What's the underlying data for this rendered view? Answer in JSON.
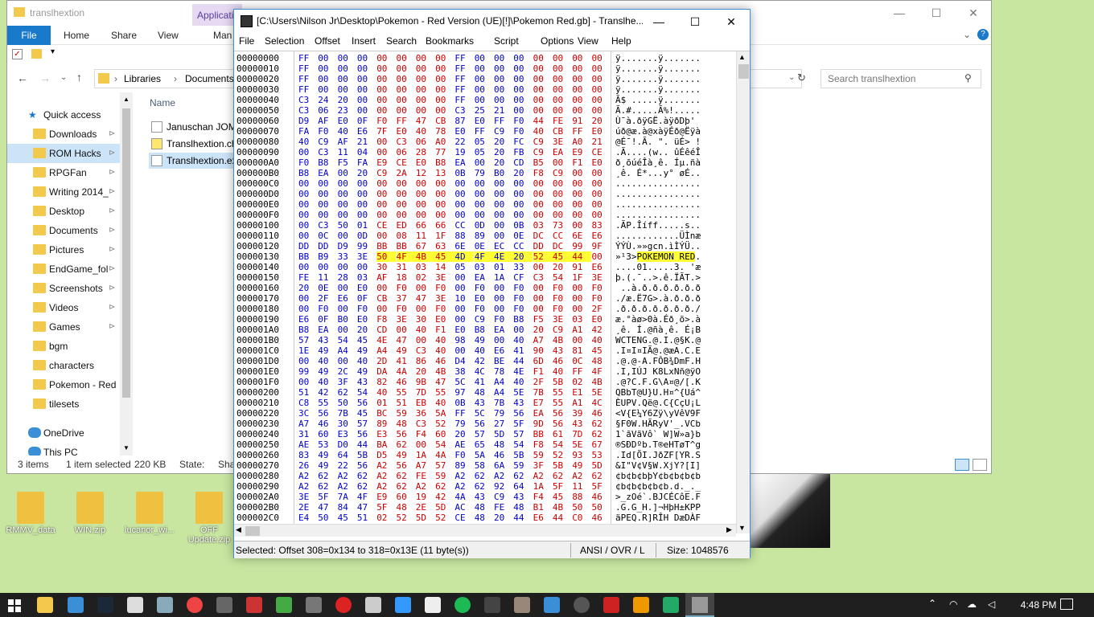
{
  "explorer": {
    "title": "translhextion",
    "app_tab": "Application",
    "ribbon_tabs": [
      "File",
      "Home",
      "Share",
      "View",
      "Man"
    ],
    "breadcrumb": [
      "Libraries",
      "Documents"
    ],
    "search_placeholder": "Search translhextion",
    "column_name": "Name",
    "nav_items": [
      {
        "label": "Quick access",
        "pinned": false
      },
      {
        "label": "Downloads",
        "pinned": true
      },
      {
        "label": "ROM Hacks",
        "pinned": true,
        "selected": true
      },
      {
        "label": "RPGFan",
        "pinned": true
      },
      {
        "label": "Writing 2014_",
        "pinned": true
      },
      {
        "label": "Desktop",
        "pinned": true
      },
      {
        "label": "Documents",
        "pinned": true
      },
      {
        "label": "Pictures",
        "pinned": true
      },
      {
        "label": "EndGame_fol",
        "pinned": true
      },
      {
        "label": "Screenshots",
        "pinned": true
      },
      {
        "label": "Videos",
        "pinned": true
      },
      {
        "label": "Games",
        "pinned": true
      },
      {
        "label": "bgm",
        "pinned": false
      },
      {
        "label": "characters",
        "pinned": false
      },
      {
        "label": "Pokemon - Red",
        "pinned": false
      },
      {
        "label": "tilesets",
        "pinned": false
      },
      {
        "label": "OneDrive",
        "pinned": false
      },
      {
        "label": "This PC",
        "pinned": false
      }
    ],
    "files": [
      "Januschan JOM",
      "Translhextion.ch",
      "Translhextion.ex"
    ],
    "status": {
      "items": "3 items",
      "selected": "1 item selected",
      "size": "220 KB",
      "state": "State:",
      "state_val": "Sha"
    }
  },
  "desktop_icons": [
    "RMMV_data",
    "WIN.zip",
    "lucanor_wi...",
    "OFF Update.zip"
  ],
  "hexeditor": {
    "title": "[C:\\Users\\Nilson Jr\\Desktop\\Pokemon - Red Version (UE)[!]\\Pokemon Red.gb] - Translhe...",
    "menu": [
      "File",
      "Selection",
      "Offset",
      "Insert",
      "Search",
      "Bookmarks",
      "Script",
      "Options",
      "View",
      "Help"
    ],
    "rows": [
      {
        "off": "00000000",
        "hex": "FF 00 00 00 00 00 00 00 FF 00 00 00 00 00 00 00",
        "asc": "ÿ.......ÿ......."
      },
      {
        "off": "00000010",
        "hex": "FF 00 00 00 00 00 00 00 FF 00 00 00 00 00 00 00",
        "asc": "ÿ.......ÿ......."
      },
      {
        "off": "00000020",
        "hex": "FF 00 00 00 00 00 00 00 FF 00 00 00 00 00 00 00",
        "asc": "ÿ.......ÿ......."
      },
      {
        "off": "00000030",
        "hex": "FF 00 00 00 00 00 00 00 FF 00 00 00 00 00 00 00",
        "asc": "ÿ.......ÿ......."
      },
      {
        "off": "00000040",
        "hex": "C3 24 20 00 00 00 00 00 FF 00 00 00 00 00 00 00",
        "asc": "Ã$ .....ÿ......."
      },
      {
        "off": "00000050",
        "hex": "C3 06 23 00 00 00 00 00 C3 25 21 00 00 00 00 00",
        "asc": "Ã.#.....Ã%!....."
      },
      {
        "off": "00000060",
        "hex": "D9 AF E0 0F F0 FF 47 CB 87 E0 FF F0 44 FE 91 20",
        "asc": "Ù¯à.ðÿGË.àÿðDþ' "
      },
      {
        "off": "00000070",
        "hex": "FA F0 40 E6 7F E0 40 78 E0 FF C9 F0 40 CB FF E0",
        "asc": "úð@æ.à@xàÿÉð@Ëÿà"
      },
      {
        "off": "00000080",
        "hex": "40 C9 AF 21 00 C3 06 A0 22 05 20 FC C9 3E A0 21",
        "asc": "@É¯!.Ã. \". üÉ> !"
      },
      {
        "off": "00000090",
        "hex": "00 C3 11 04 00 06 28 77 19 05 20 FB C9 EA E9 CE",
        "asc": ".Ã....(w.. ûÉêéÎ"
      },
      {
        "off": "000000A0",
        "hex": "F0 B8 F5 FA E9 CE E0 B8 EA 00 20 CD B5 00 F1 E0",
        "asc": "ð¸õúéÎà¸ê. Íµ.ñà"
      },
      {
        "off": "000000B0",
        "hex": "B8 EA 00 20 C9 2A 12 13 0B 79 B0 20 F8 C9 00 00",
        "asc": "¸ê. É*...y° øÉ.."
      },
      {
        "off": "000000C0",
        "hex": "00 00 00 00 00 00 00 00 00 00 00 00 00 00 00 00",
        "asc": "................"
      },
      {
        "off": "000000D0",
        "hex": "00 00 00 00 00 00 00 00 00 00 00 00 00 00 00 00",
        "asc": "................"
      },
      {
        "off": "000000E0",
        "hex": "00 00 00 00 00 00 00 00 00 00 00 00 00 00 00 00",
        "asc": "................"
      },
      {
        "off": "000000F0",
        "hex": "00 00 00 00 00 00 00 00 00 00 00 00 00 00 00 00",
        "asc": "................"
      },
      {
        "off": "00000100",
        "hex": "00 C3 50 01 CE ED 66 66 CC 0D 00 0B 03 73 00 83",
        "asc": ".ÃP.Îíff.....s.."
      },
      {
        "off": "00000110",
        "hex": "00 0C 00 0D 00 08 11 1F 88 89 00 0E DC CC 6E E6",
        "asc": "............ÜÌnæ"
      },
      {
        "off": "00000120",
        "hex": "DD DD D9 99 BB BB 67 63 6E 0E EC CC DD DC 99 9F",
        "asc": "ÝÝÙ.»»gcn.ìÌÝÜ.."
      },
      {
        "off": "00000130",
        "hex": "BB B9 33 3E 50 4F 4B 45 4D 4F 4E 20 52 45 44 00",
        "asc": "»¹3>POKEMON RED.",
        "hl_from": 4,
        "hl_to": 14
      },
      {
        "off": "00000140",
        "hex": "00 00 00 00 30 31 03 14 05 03 01 33 00 20 91 E6",
        "asc": "....01.....3. 'æ"
      },
      {
        "off": "00000150",
        "hex": "FE 11 28 03 AF 18 02 3E 00 EA 1A CF C3 54 1F 3E",
        "asc": "þ.(.¯..>.ê.ÏÃT.>"
      },
      {
        "off": "00000160",
        "hex": "20 0E 00 E0 00 F0 00 F0 00 F0 00 F0 00 F0 00 F0",
        "asc": " ..à.ð.ð.ð.ð.ð.ð"
      },
      {
        "off": "00000170",
        "hex": "00 2F E6 0F CB 37 47 3E 10 E0 00 F0 00 F0 00 F0",
        "asc": "./æ.Ë7G>.à.ð.ð.ð"
      },
      {
        "off": "00000180",
        "hex": "00 F0 00 F0 00 F0 00 F0 00 F0 00 F0 00 F0 00 2F",
        "asc": ".ð.ð.ð.ð.ð.ð.ð./"
      },
      {
        "off": "00000190",
        "hex": "E6 0F B0 E0 F8 3E 30 E0 00 C9 F0 B8 F5 3E 03 E0",
        "asc": "æ.°àø>0à.Éð¸õ>.à"
      },
      {
        "off": "000001A0",
        "hex": "B8 EA 00 20 CD 00 40 F1 E0 B8 EA 00 20 C9 A1 42",
        "asc": "¸ê. Í.@ñà¸ê. É¡B"
      },
      {
        "off": "000001B0",
        "hex": "57 43 54 45 4E 47 00 40 98 49 00 40 A7 4B 00 40",
        "asc": "WCTENG.@.I.@§K.@"
      },
      {
        "off": "000001C0",
        "hex": "1E 49 A4 49 A4 49 C3 40 00 40 E6 41 90 43 81 45",
        "asc": ".I¤I¤IÃ@.@æA.C.E"
      },
      {
        "off": "000001D0",
        "hex": "00 40 00 40 2D 41 86 46 D4 42 BE 44 6D 46 0C 48",
        "asc": ".@.@-A.FÔB¾DmF.H"
      },
      {
        "off": "000001E0",
        "hex": "99 49 2C 49 DA 4A 20 4B 38 4C 78 4E F1 40 FF 4F",
        "asc": ".I,IÚJ K8LxNñ@ÿO"
      },
      {
        "off": "000001F0",
        "hex": "00 40 3F 43 82 46 9B 47 5C 41 A4 40 2F 5B 02 4B",
        "asc": ".@?C.F.G\\A¤@/[.K"
      },
      {
        "off": "00000200",
        "hex": "51 42 62 54 40 55 7D 55 97 48 A4 5E 7B 55 E1 5E",
        "asc": "QBbT@U}U.H¤^{Uá^"
      },
      {
        "off": "00000210",
        "hex": "C8 55 50 56 01 51 EB 40 0B 43 7B 43 E7 55 A1 4C",
        "asc": "ÈUPV.Që@.C{CçU¡L"
      },
      {
        "off": "00000220",
        "hex": "3C 56 7B 45 BC 59 36 5A FF 5C 79 56 EA 56 39 46",
        "asc": "<V{E¼Y6Zÿ\\yVêV9F"
      },
      {
        "off": "00000230",
        "hex": "A7 46 30 57 89 48 C3 52 79 56 27 5F 9D 56 43 62",
        "asc": "§F0W.HÃRyV'_.VCb"
      },
      {
        "off": "00000240",
        "hex": "31 60 E3 56 E3 56 F4 60 20 57 5D 57 BB 61 7D 62",
        "asc": "1`ãVãVô` W]W»a}b"
      },
      {
        "off": "00000250",
        "hex": "AE 53 D0 44 BA 62 00 54 AE 65 48 54 F8 54 5E 67",
        "asc": "®SÐDºb.T®eHTøT^g"
      },
      {
        "off": "00000260",
        "hex": "83 49 64 5B D5 49 1A 4A F0 5A 46 5B 59 52 93 53",
        "asc": ".Id[ÕI.JðZF[YR.S"
      },
      {
        "off": "00000270",
        "hex": "26 49 22 56 A2 56 A7 57 89 58 6A 59 3F 5B 49 5D",
        "asc": "&I\"V¢V§W.XjY?[I]"
      },
      {
        "off": "00000280",
        "hex": "A2 62 A2 62 A2 62 FE 59 A2 62 A2 62 A2 62 A2 62",
        "asc": "¢b¢b¢bþY¢b¢b¢b¢b"
      },
      {
        "off": "00000290",
        "hex": "A2 62 A2 62 A2 62 A2 62 A2 62 92 64 1A 5F 11 5F",
        "asc": "¢b¢b¢b¢b¢b.d._._"
      },
      {
        "off": "000002A0",
        "hex": "3E 5F 7A 4F E9 60 19 42 4A 43 C9 43 F4 45 88 46",
        "asc": ">_zOé`.BJCÉCôE.F"
      },
      {
        "off": "000002B0",
        "hex": "2E 47 84 47 5F 48 2E 5D AC 48 FE 48 B1 4B 50 50",
        "asc": ".G.G_H.]¬HþH±KPP"
      },
      {
        "off": "000002C0",
        "hex": "E4 50 45 51 02 52 5D 52 CE 48 20 44 E6 44 C0 46",
        "asc": "äPEQ.R]RÎH DæDÀF"
      }
    ],
    "status_selected": "Selected: Offset 308=0x134 to 318=0x13E (11 byte(s))",
    "status_mode": "ANSI / OVR / L",
    "status_size": "Size: 1048576"
  },
  "taskbar": {
    "time": "4:48 PM"
  }
}
